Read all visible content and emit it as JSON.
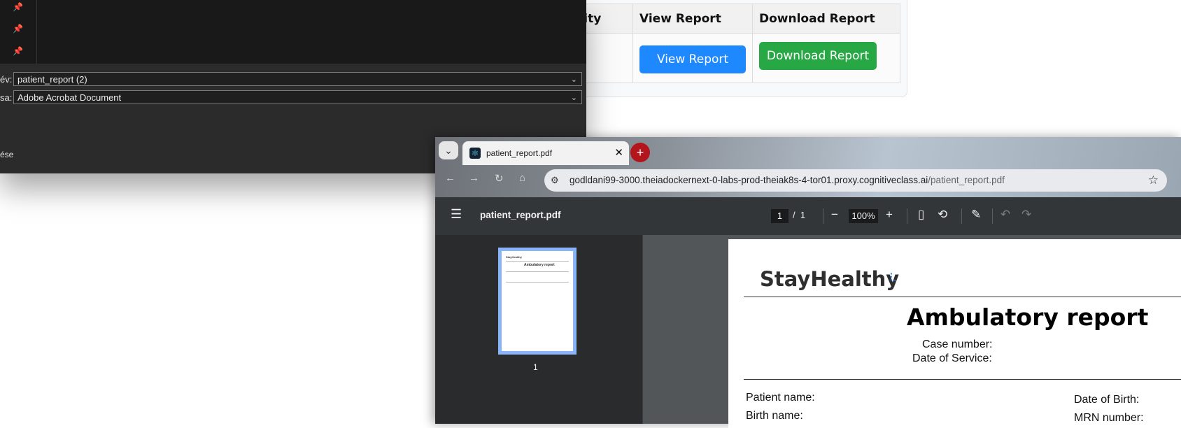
{
  "web_table": {
    "headers": [
      "ality",
      "View Report",
      "Download Report"
    ],
    "view_button": "View Report",
    "download_button": "Download Report"
  },
  "save_dialog": {
    "filename_label": "év:",
    "filename_value": "patient_report (2)",
    "type_label": "sa:",
    "type_value": "Adobe Acrobat Document",
    "bottom_text": "ése",
    "pins": [
      "pin-icon",
      "pin-icon",
      "pin-icon"
    ]
  },
  "browser": {
    "tab_title": "patient_report.pdf",
    "url_host": "godldani99-3000.theiadockernext-0-labs-prod-theiak8s-4-tor01.proxy.cognitiveclass.ai",
    "url_path": "/patient_report.pdf",
    "new_tab_symbol": "+",
    "tab_close_symbol": "✕"
  },
  "pdf_viewer": {
    "file_name": "patient_report.pdf",
    "current_page": "1",
    "page_separator": "/",
    "total_pages": "1",
    "zoom": "100%",
    "thumbnail_label": "1",
    "page": {
      "logo_text": "StayHealthy",
      "title": "Ambulatory report",
      "case_number_label": "Case number:",
      "date_of_service_label": "Date of Service:",
      "patient_name_label": "Patient name:",
      "date_of_birth_label": "Date of Birth:",
      "birth_name_label": "Birth name:",
      "mrn_label": "MRN number:"
    },
    "thumbnail_text": {
      "logo": "StayHealthy",
      "title": "Ambulatory report"
    }
  },
  "colors": {
    "view_button": "#1e88ff",
    "download_button": "#28a745",
    "new_tab": "#b3151c",
    "thumb_highlight": "#8ab4f8",
    "logo_accent": "#2b7de9"
  }
}
